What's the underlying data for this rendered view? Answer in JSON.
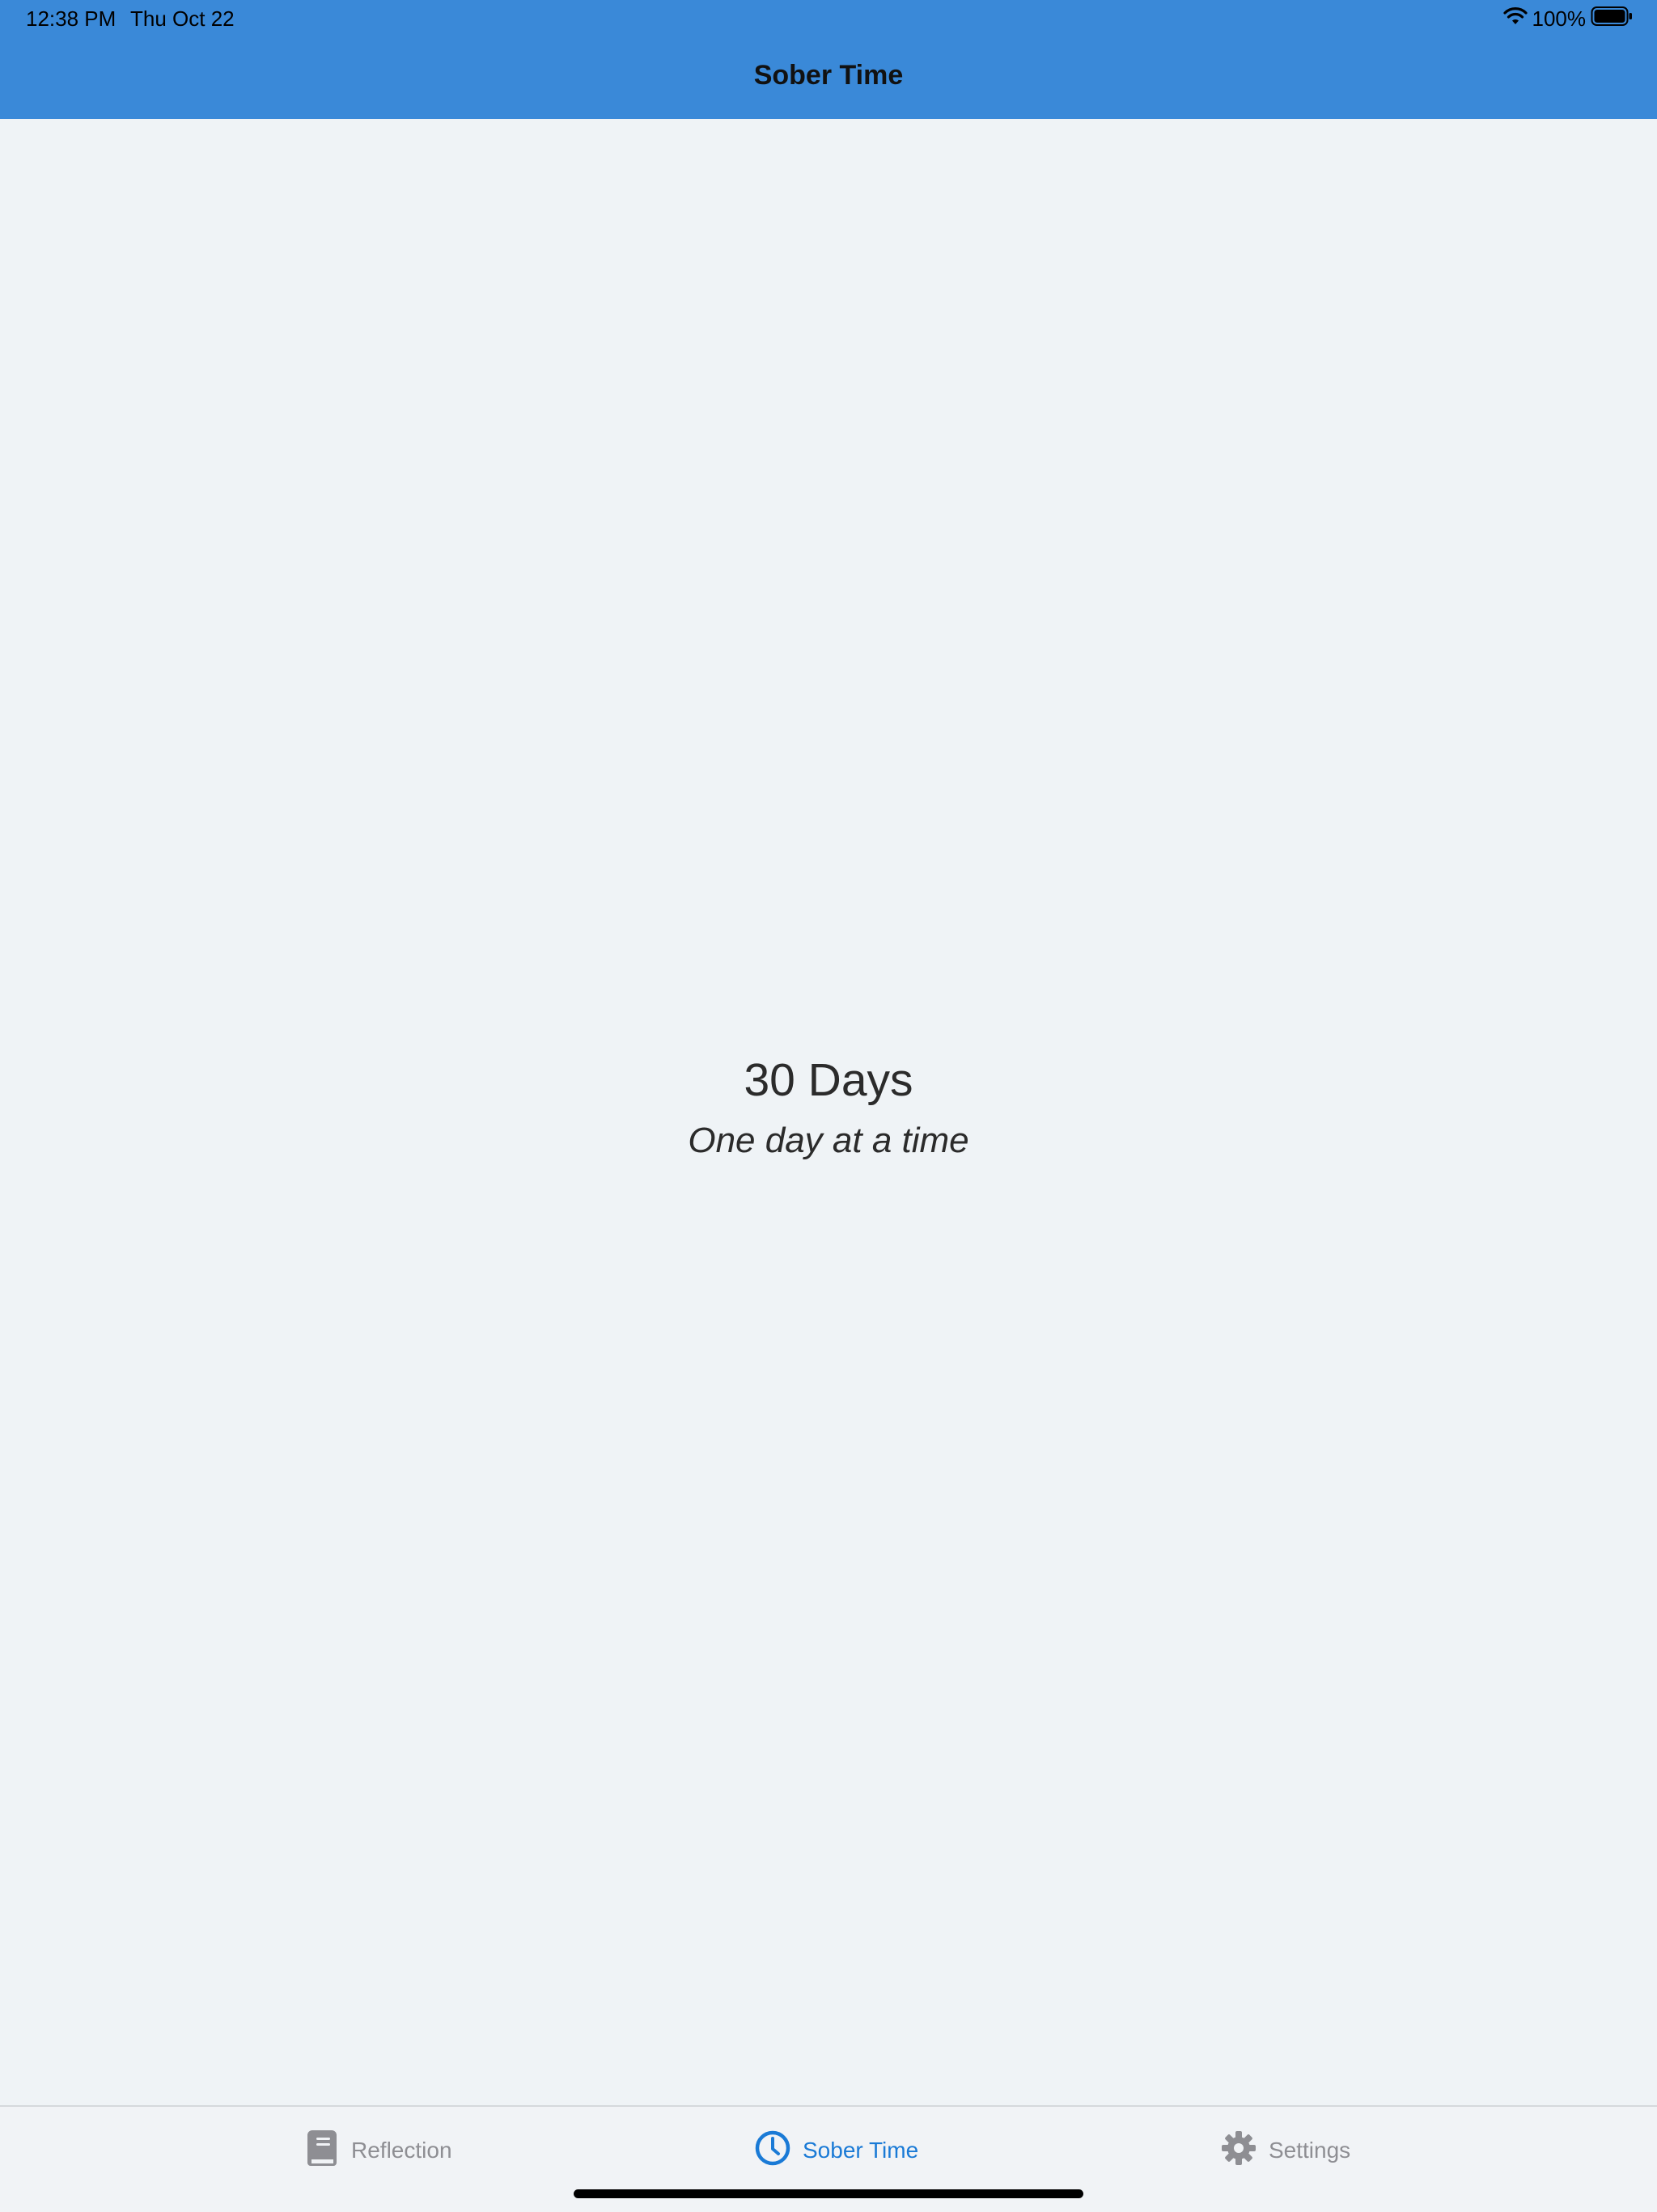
{
  "status_bar": {
    "time": "12:38 PM",
    "date": "Thu Oct 22",
    "battery": "100%"
  },
  "header": {
    "title": "Sober Time"
  },
  "main": {
    "counter": "30 Days",
    "tagline": "One day at a time"
  },
  "tab_bar": {
    "tabs": [
      {
        "label": "Reflection",
        "icon": "book-icon",
        "active": false
      },
      {
        "label": "Sober Time",
        "icon": "clock-icon",
        "active": true
      },
      {
        "label": "Settings",
        "icon": "gear-icon",
        "active": false
      }
    ]
  },
  "colors": {
    "header_bg": "#3a89d8",
    "background": "#eff3f6",
    "tab_active": "#1a7ad6",
    "tab_inactive": "#8e8e93"
  }
}
